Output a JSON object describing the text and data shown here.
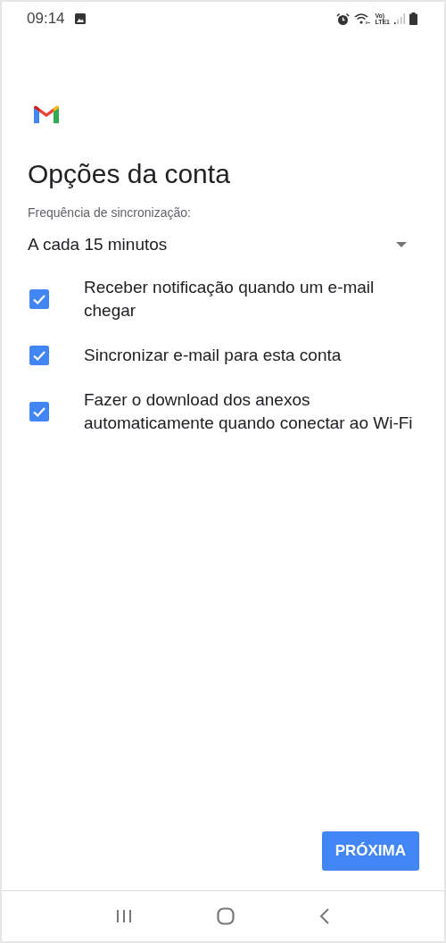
{
  "status_bar": {
    "time": "09:14",
    "volte": "Vo)",
    "lte": "LTE1"
  },
  "title": "Opções da conta",
  "sync_frequency": {
    "label": "Frequência de sincronização:",
    "value": "A cada 15 minutos"
  },
  "options": [
    {
      "label": "Receber notificação quando um e-mail chegar",
      "checked": true
    },
    {
      "label": "Sincronizar e-mail para esta conta",
      "checked": true
    },
    {
      "label": "Fazer o download dos anexos automaticamente quando conectar ao Wi-Fi",
      "checked": true
    }
  ],
  "next_button": "PRÓXIMA"
}
